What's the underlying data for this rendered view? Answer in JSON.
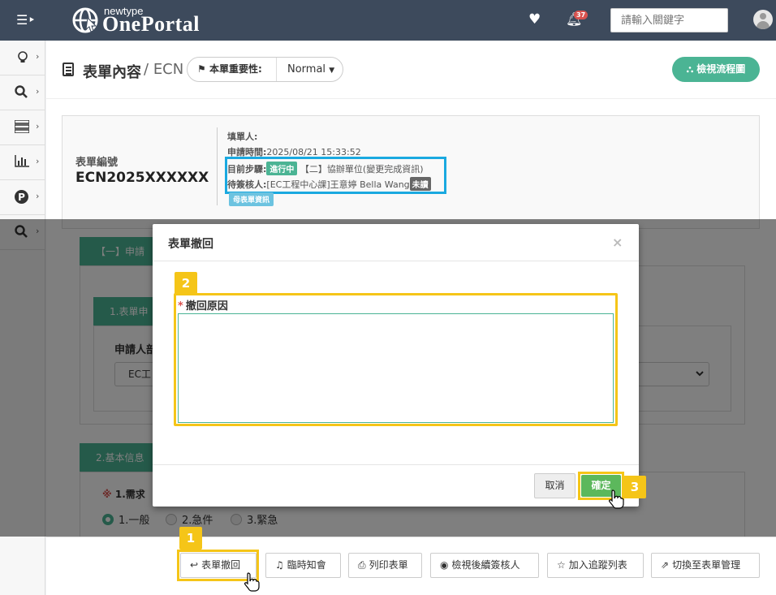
{
  "app": {
    "logo_small": "newtype",
    "logo_big": "OnePortal",
    "notification_count": "37",
    "search_placeholder": "請輸入關鍵字"
  },
  "header": {
    "title": "表單內容",
    "separator": "/",
    "form_type": "ECN",
    "importance_label": "本單重要性:",
    "importance_value": "Normal",
    "view_flow_label": "檢視流程圖"
  },
  "info": {
    "form_no_label": "表單編號",
    "form_no": "ECN2025XXXXXX",
    "filler_label": "填單人:",
    "apply_time_label": "申請時間:",
    "apply_time": "2025/08/21 15:33:52",
    "current_step_label": "目前步驟:",
    "current_step_status": "進行中",
    "current_step": "【二】協辦單位(變更完成資訊)",
    "pending_label": "待簽核人:",
    "pending": "[EC工程中心課]王意婷 Bella Wang",
    "pending_status": "未讀",
    "parent_form_tag": "母表單資訊"
  },
  "form": {
    "section1_title": "【一】申請",
    "sub1_title": "1.表單申",
    "applicant_label": "申請人部",
    "applicant_value": "EC工",
    "section2_title": "2.基本信息",
    "urgency_label": "1.需求",
    "urgency_options": [
      "1.一般",
      "2.急件",
      "3.緊急"
    ]
  },
  "modal": {
    "title": "表單撤回",
    "close": "×",
    "reason_label": "撤回原因",
    "reason_required": "*",
    "reason_value": "",
    "cancel_label": "取消",
    "ok_label": "確定"
  },
  "steps": [
    "1",
    "2",
    "3"
  ],
  "actions": [
    {
      "label": "表單撤回",
      "icon": "reply-icon"
    },
    {
      "label": "臨時知會",
      "icon": "bell-icon"
    },
    {
      "label": "列印表單",
      "icon": "print-icon"
    },
    {
      "label": "檢視後續簽核人",
      "icon": "eye-icon"
    },
    {
      "label": "加入追蹤列表",
      "icon": "star-icon"
    },
    {
      "label": "切換至表單管理",
      "icon": "external-link-icon"
    }
  ],
  "colors": {
    "navbar": "#3d4a5c",
    "accent_green": "#4bb494",
    "highlight_yellow": "#f5c518",
    "highlight_blue": "#1aa9e0",
    "ok_green": "#5cb85c"
  }
}
